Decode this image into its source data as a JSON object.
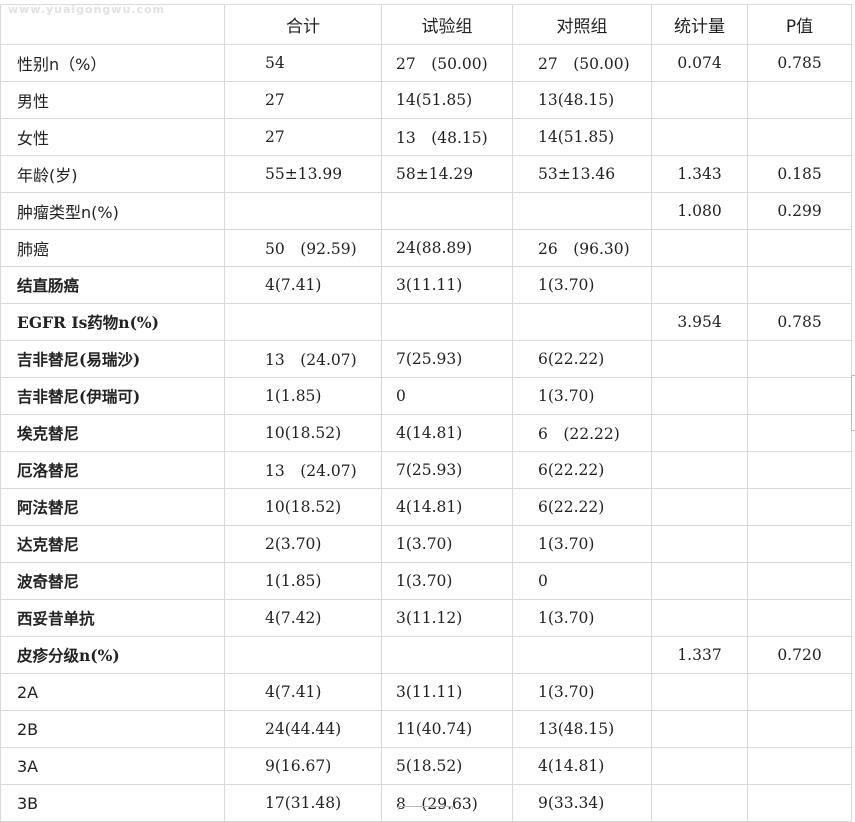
{
  "watermark": "www.yuaigongwu.com",
  "table": {
    "headers": [
      "",
      "合计",
      "试验组",
      "对照组",
      "统计量",
      "P值"
    ],
    "rows": [
      {
        "label": "性别n（%）",
        "bold": false,
        "cells": [
          "54",
          "27　(50.00)",
          "27　(50.00)",
          "0.074",
          "0.785"
        ]
      },
      {
        "label": "男性",
        "bold": false,
        "cells": [
          "27",
          "14(51.85)",
          "13(48.15)",
          "",
          ""
        ]
      },
      {
        "label": "女性",
        "bold": false,
        "cells": [
          "27",
          "13　(48.15)",
          "14(51.85)",
          "",
          ""
        ]
      },
      {
        "label": "年龄(岁)",
        "bold": false,
        "cells": [
          "55±13.99",
          "58±14.29",
          "53±13.46",
          "1.343",
          "0.185"
        ]
      },
      {
        "label": "肿瘤类型n(%)",
        "bold": false,
        "cells": [
          "",
          "",
          "",
          "1.080",
          "0.299"
        ]
      },
      {
        "label": "肺癌",
        "bold": false,
        "cells": [
          "50　(92.59)",
          "24(88.89)",
          "26　(96.30)",
          "",
          ""
        ]
      },
      {
        "label": "结直肠癌",
        "bold": true,
        "cells": [
          "4(7.41)",
          "3(11.11)",
          "1(3.70)",
          "",
          ""
        ]
      },
      {
        "label": "EGFR Is药物n(%)",
        "bold": true,
        "cells": [
          "",
          "",
          "",
          "3.954",
          "0.785"
        ]
      },
      {
        "label": "吉非替尼(易瑞沙)",
        "bold": true,
        "cells": [
          "13　(24.07)",
          "7(25.93)",
          "6(22.22)",
          "",
          ""
        ]
      },
      {
        "label": "吉非替尼(伊瑞可)",
        "bold": true,
        "cells": [
          "1(1.85)",
          "0",
          "1(3.70)",
          "",
          ""
        ]
      },
      {
        "label": "埃克替尼",
        "bold": true,
        "cells": [
          "10(18.52)",
          "4(14.81)",
          "6　(22.22)",
          "",
          ""
        ]
      },
      {
        "label": "厄洛替尼",
        "bold": true,
        "cells": [
          "13　(24.07)",
          "7(25.93)",
          "6(22.22)",
          "",
          ""
        ]
      },
      {
        "label": "阿法替尼",
        "bold": true,
        "cells": [
          "10(18.52)",
          "4(14.81)",
          "6(22.22)",
          "",
          ""
        ]
      },
      {
        "label": "达克替尼",
        "bold": true,
        "cells": [
          "2(3.70)",
          "1(3.70)",
          "1(3.70)",
          "",
          ""
        ]
      },
      {
        "label": "波奇替尼",
        "bold": true,
        "cells": [
          "1(1.85)",
          "1(3.70)",
          "0",
          "",
          ""
        ]
      },
      {
        "label": "西妥昔单抗",
        "bold": true,
        "cells": [
          "4(7.42)",
          "3(11.12)",
          "1(3.70)",
          "",
          ""
        ]
      },
      {
        "label": "皮疹分级n(%)",
        "bold": true,
        "cells": [
          "",
          "",
          "",
          "1.337",
          "0.720"
        ]
      },
      {
        "label": "2A",
        "bold": false,
        "cells": [
          "4(7.41)",
          "3(11.11)",
          "1(3.70)",
          "",
          ""
        ]
      },
      {
        "label": "2B",
        "bold": false,
        "cells": [
          "24(44.44)",
          "11(40.74)",
          "13(48.15)",
          "",
          ""
        ]
      },
      {
        "label": "3A",
        "bold": false,
        "cells": [
          "9(16.67)",
          "5(18.52)",
          "4(14.81)",
          "",
          ""
        ]
      },
      {
        "label": "3B",
        "bold": false,
        "cells": [
          "17(31.48)",
          "8　(29.63)",
          "9(33.34)",
          "",
          ""
        ]
      }
    ]
  }
}
